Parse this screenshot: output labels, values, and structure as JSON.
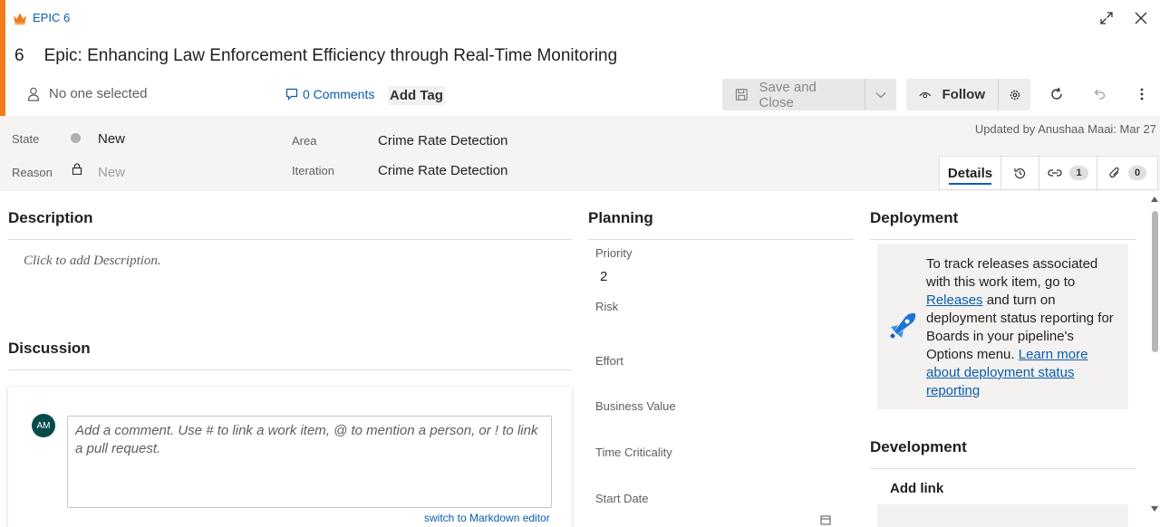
{
  "header": {
    "breadcrumb": "EPIC 6",
    "id": "6",
    "title": "Epic: Enhancing Law Enforcement Efficiency through Real-Time Monitoring",
    "assignee": "No one selected",
    "comments": "0 Comments",
    "add_tag": "Add Tag",
    "accent_color": "#f07c1a"
  },
  "toolbar": {
    "save_label": "Save and Close",
    "follow_label": "Follow"
  },
  "state": {
    "state_label": "State",
    "state_value": "New",
    "reason_label": "Reason",
    "reason_value": "New",
    "area_label": "Area",
    "area_value": "Crime Rate Detection",
    "iteration_label": "Iteration",
    "iteration_value": "Crime Rate Detection",
    "updated": "Updated by Anushaa Maai: Mar 27"
  },
  "tabs": {
    "details": "Details",
    "links_count": "1",
    "attachments_count": "0"
  },
  "description": {
    "title": "Description",
    "placeholder": "Click to add Description."
  },
  "discussion": {
    "title": "Discussion",
    "avatar_initials": "AM",
    "placeholder": "Add a comment. Use # to link a work item, @ to mention a person, or ! to link a pull request.",
    "markdown_link": "switch to Markdown editor"
  },
  "planning": {
    "title": "Planning",
    "priority_label": "Priority",
    "priority_value": "2",
    "risk_label": "Risk",
    "effort_label": "Effort",
    "business_value_label": "Business Value",
    "time_criticality_label": "Time Criticality",
    "start_date_label": "Start Date"
  },
  "deployment": {
    "title": "Deployment",
    "text1": "To track releases associated with this work item, go to",
    "releases_link": "Releases",
    "text2": "and turn on deployment status reporting for Boards in your pipeline's Options menu.",
    "learn_more": "Learn more about deployment status reporting"
  },
  "development": {
    "title": "Development",
    "add_link": "Add link"
  }
}
